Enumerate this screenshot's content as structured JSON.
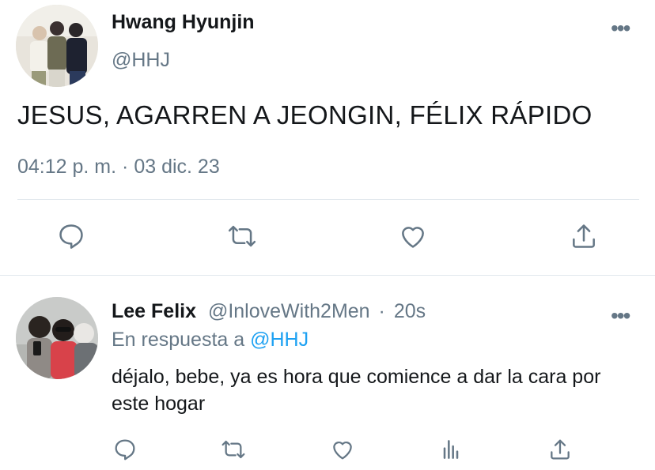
{
  "tweet": {
    "author_name": "Hwang Hyunjin",
    "author_handle": "@HHJ",
    "text": "JESUS, AGARREN A JEONGIN, FÉLIX RÁPIDO",
    "time": "04:12 p. m.",
    "separator": "·",
    "date": "03 dic. 23",
    "actions": [
      "reply-icon",
      "retweet-icon",
      "like-icon",
      "share-icon"
    ]
  },
  "reply": {
    "author_name": "Lee Felix",
    "author_handle": "@InloveWith2Men",
    "separator": "·",
    "age": "20s",
    "replying_prefix": "En respuesta a",
    "replying_to": "@HHJ",
    "text": "déjalo, bebe, ya es hora que comience a dar la cara por este hogar",
    "actions": [
      "reply-icon",
      "retweet-icon",
      "like-icon",
      "analytics-icon",
      "share-icon"
    ]
  },
  "more_glyph": "•••",
  "colors": {
    "text": "#14171a",
    "secondary": "#657786",
    "link": "#1da1f2",
    "divider": "#e1e8ed"
  }
}
